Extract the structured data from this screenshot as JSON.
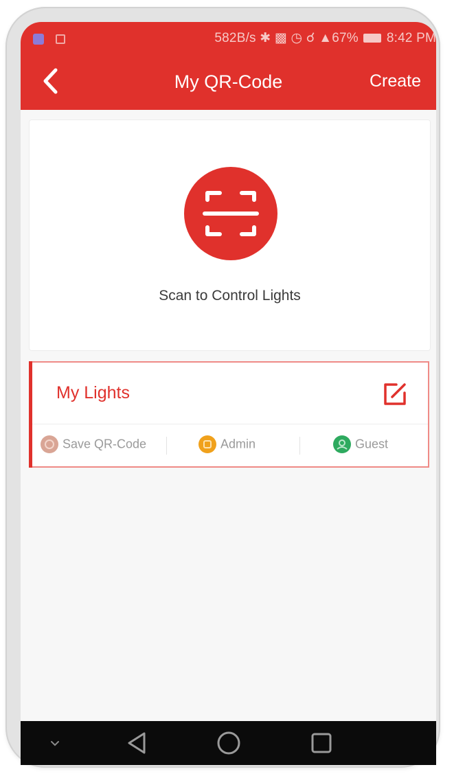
{
  "status_bar": {
    "speed": "582B/s",
    "signal": "67%",
    "time": "8:42 PM"
  },
  "header": {
    "title": "My QR-Code",
    "create_label": "Create",
    "background_color": "#e0312c"
  },
  "scan": {
    "label": "Scan to Control Lights",
    "icon": "qr-scan-icon"
  },
  "lights_card": {
    "title": "My Lights",
    "edit_icon": "edit-icon",
    "actions": [
      {
        "label": "Save QR-Code",
        "icon": "save-icon",
        "color": "#d9a595"
      },
      {
        "label": "Admin",
        "icon": "admin-icon",
        "color": "#f0a11c"
      },
      {
        "label": "Guest",
        "icon": "guest-icon",
        "color": "#2eaa5f"
      }
    ]
  },
  "nav_bar": {
    "buttons": [
      "chevron-down-icon",
      "back-triangle-icon",
      "home-circle-icon",
      "recents-square-icon"
    ]
  }
}
